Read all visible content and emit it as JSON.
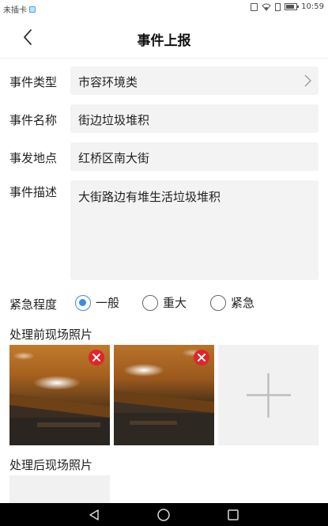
{
  "status_bar": {
    "carrier": "未插卡",
    "time": "10:59",
    "icons": [
      "sim-card-icon",
      "vibrate-icon",
      "wifi-icon",
      "sim-icon",
      "battery-icon"
    ]
  },
  "header": {
    "title": "事件上报",
    "back_icon": "chevron-left-icon"
  },
  "form": {
    "type": {
      "label": "事件类型",
      "value": "市容环境类"
    },
    "name": {
      "label": "事件名称",
      "value": "街边垃圾堆积"
    },
    "location": {
      "label": "事发地点",
      "value": "红桥区南大街"
    },
    "description": {
      "label": "事件描述",
      "value": "大街路边有堆生活垃圾堆积"
    },
    "urgency": {
      "label": "紧急程度",
      "options": [
        "一般",
        "重大",
        "紧急"
      ],
      "selected": "一般"
    }
  },
  "photos_before": {
    "title": "处理前现场照片",
    "count": 2
  },
  "photos_after": {
    "title": "处理后现场照片"
  },
  "colors": {
    "accent": "#3c8be6",
    "delete": "#e0242c",
    "field_bg": "#f3f3f3"
  },
  "system_nav": [
    "back-triangle-icon",
    "home-circle-icon",
    "recents-square-icon"
  ]
}
